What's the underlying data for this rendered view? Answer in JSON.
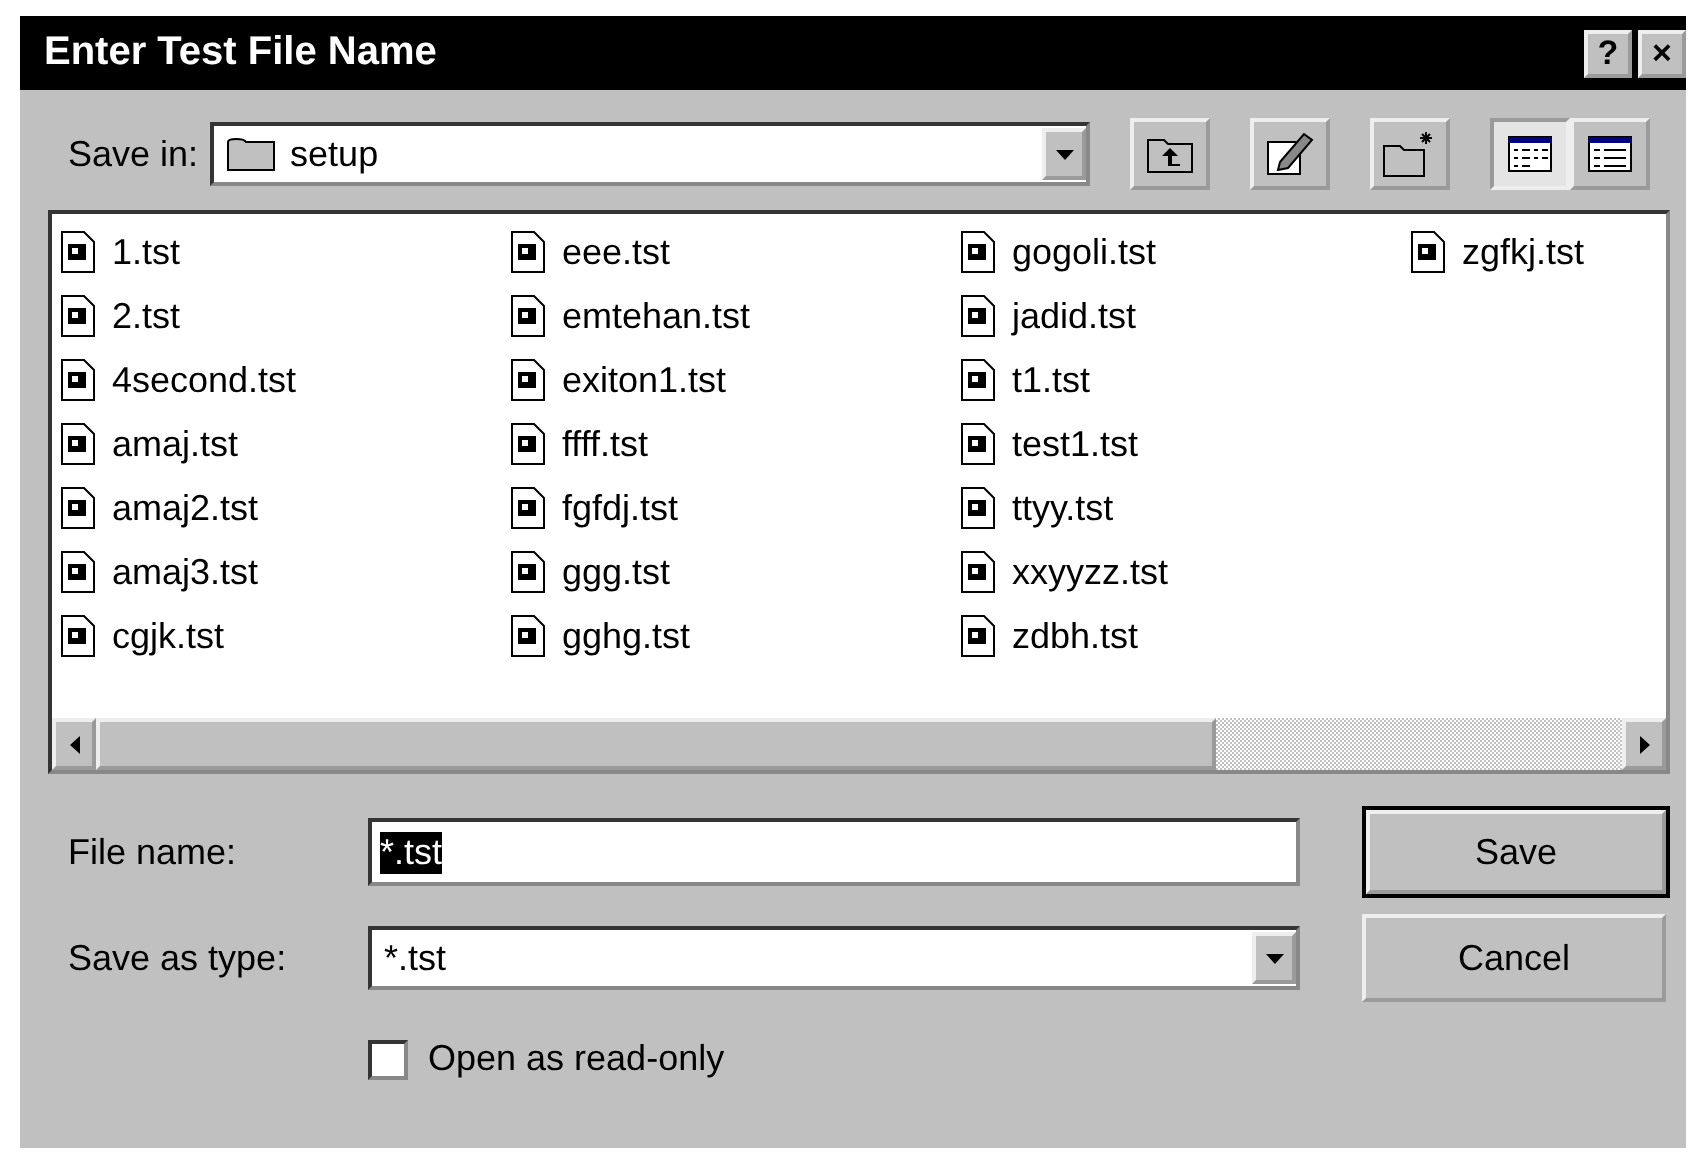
{
  "window": {
    "title": "Enter Test File Name",
    "help_button": "?",
    "close_button": "×"
  },
  "save_in": {
    "label": "Save in:",
    "value": "setup"
  },
  "toolbar": [
    {
      "kind": "up"
    },
    {
      "kind": "desktop"
    },
    {
      "kind": "new-folder"
    },
    {
      "kind": "list",
      "selected": true
    },
    {
      "kind": "details",
      "selected": false
    }
  ],
  "files": [
    {
      "name": "1.tst",
      "selected": false
    },
    {
      "name": "2.tst",
      "selected": false
    },
    {
      "name": "4second.tst",
      "selected": false
    },
    {
      "name": "amaj.tst",
      "selected": false
    },
    {
      "name": "amaj2.tst",
      "selected": false
    },
    {
      "name": "amaj3.tst",
      "selected": false
    },
    {
      "name": "cgjk.tst",
      "selected": false
    },
    {
      "name": "eee.tst",
      "selected": false
    },
    {
      "name": "emtehan.tst",
      "selected": false
    },
    {
      "name": "exiton1.tst",
      "selected": false
    },
    {
      "name": "ffff.tst",
      "selected": false
    },
    {
      "name": "fgfdj.tst",
      "selected": false
    },
    {
      "name": "ggg.tst",
      "selected": false
    },
    {
      "name": "gghg.tst",
      "selected": false
    },
    {
      "name": "gogoli.tst",
      "selected": false
    },
    {
      "name": "jadid.tst",
      "selected": false
    },
    {
      "name": "t1.tst",
      "selected": false
    },
    {
      "name": "test1.tst",
      "selected": false
    },
    {
      "name": "ttyy.tst",
      "selected": false
    },
    {
      "name": "xxyyzz.tst",
      "selected": false
    },
    {
      "name": "zdbh.tst",
      "selected": false
    },
    {
      "name": "zgfkj.tst",
      "selected": false
    }
  ],
  "file_name": {
    "label": "File name:",
    "value": "*.tst"
  },
  "save_as_type": {
    "label": "Save as type:",
    "value": "*.tst"
  },
  "buttons": [
    {
      "label": "Save",
      "default": true
    },
    {
      "label": "Cancel",
      "default": false
    }
  ],
  "read_only": {
    "label": "Open as read-only",
    "checked": false
  }
}
